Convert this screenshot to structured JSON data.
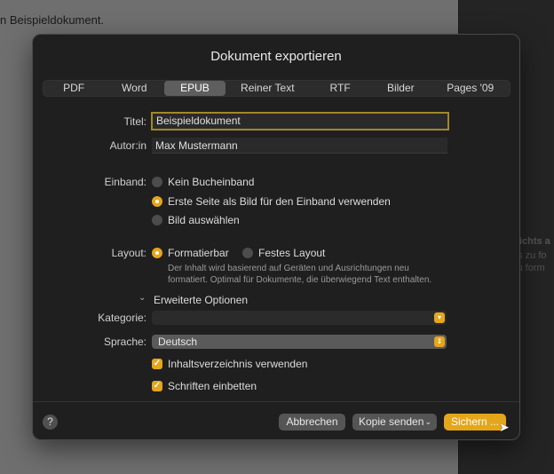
{
  "background": {
    "doc_text": "n Beispieldokument.",
    "right_panel": [
      "Nichts a",
      "as zu fo",
      "zu form"
    ]
  },
  "dialog": {
    "title": "Dokument exportieren",
    "tabs": [
      {
        "label": "PDF"
      },
      {
        "label": "Word"
      },
      {
        "label": "EPUB",
        "selected": true
      },
      {
        "label": "Reiner Text"
      },
      {
        "label": "RTF"
      },
      {
        "label": "Bilder"
      },
      {
        "label": "Pages '09"
      }
    ],
    "title_label": "Titel:",
    "title_value": "Beispieldokument",
    "author_label": "Autor:in",
    "author_value": "Max Mustermann",
    "cover_label": "Einband:",
    "cover_options": [
      {
        "label": "Kein Bucheinband",
        "selected": false
      },
      {
        "label": "Erste Seite als Bild für den Einband verwenden",
        "selected": true
      },
      {
        "label": "Bild auswählen",
        "selected": false
      }
    ],
    "layout_label": "Layout:",
    "layout_options": [
      {
        "label": "Formatierbar",
        "selected": true
      },
      {
        "label": "Festes Layout",
        "selected": false
      }
    ],
    "layout_desc": [
      "Der Inhalt wird basierend auf Geräten und Ausrichtungen neu",
      "formatiert. Optimal für Dokumente, die überwiegend Text enthalten."
    ],
    "advanced_label": "Erweiterte Optionen",
    "category_label": "Kategorie:",
    "category_value": "",
    "language_label": "Sprache:",
    "language_value": "Deutsch",
    "checkboxes": [
      {
        "label": "Inhaltsverzeichnis verwenden",
        "checked": true
      },
      {
        "label": "Schriften einbetten",
        "checked": true
      }
    ],
    "help": "?",
    "cancel": "Abbrechen",
    "send_copy": "Kopie senden",
    "save": "Sichern ..."
  },
  "colors": {
    "accent": "#e5a61b",
    "focus_ring": "#a08a2a"
  }
}
